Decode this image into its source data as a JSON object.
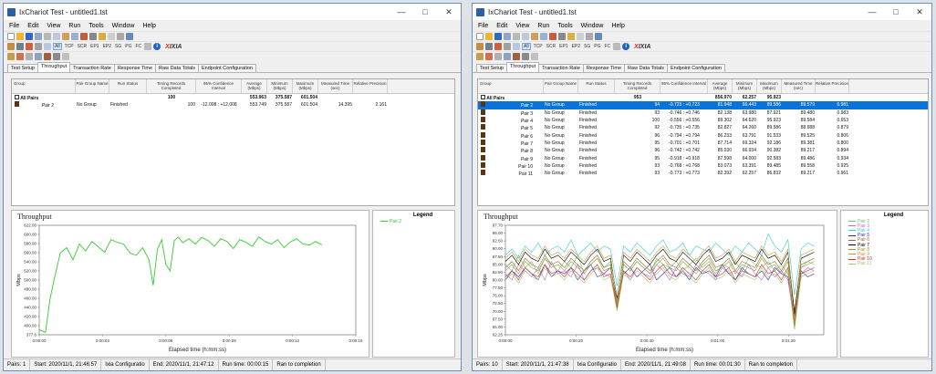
{
  "windows": [
    {
      "title": "IxChariot Test - untitled1.tst",
      "menu": [
        "File",
        "Edit",
        "View",
        "Run",
        "Tools",
        "Window",
        "Help"
      ],
      "toolbar2": [
        "All",
        "TCP",
        "SCR",
        "EP1",
        "EP2",
        "SG",
        "PG",
        "FC"
      ],
      "tabs": [
        "Test Setup",
        "Throughput",
        "Transaction Rate",
        "Response Time",
        "Raw Data Totals",
        "Endpoint Configuration"
      ],
      "active_tab": 1,
      "columns": [
        "Group",
        "Pair Group Name",
        "Run Status",
        "Timing Records Completed",
        "95% Confidence Interval",
        "Average (Mbps)",
        "Minimum (Mbps)",
        "Maximum (Mbps)",
        "Measured Time (sec)",
        "Relative Precision"
      ],
      "all_row": {
        "label": "All Pairs",
        "records": "100",
        "avg": "553.963",
        "min": "375.587",
        "max": "601.504"
      },
      "rows": [
        {
          "pair": "Pair 2",
          "group": "No Group",
          "status": "Finished",
          "records": "100",
          "ci": "-12.008 : +12.008",
          "avg": "553.749",
          "min": "375.587",
          "max": "601.504",
          "time": "14.395",
          "prec": "2.161"
        }
      ],
      "chart_title": "Throughput",
      "status": [
        "Pairs: 1",
        "Start: 2020/11/1, 21:46:57",
        "Ixia Configuratio",
        "End: 2020/11/1, 21:47:12",
        "Run time: 00:00:15",
        "Ran to completion"
      ]
    },
    {
      "title": "IxChariot Test - untitled1.tst",
      "menu": [
        "File",
        "Edit",
        "View",
        "Run",
        "Tools",
        "Window",
        "Help"
      ],
      "toolbar2": [
        "All",
        "TCP",
        "SCR",
        "EP1",
        "EP2",
        "SG",
        "PG",
        "FC"
      ],
      "tabs": [
        "Test Setup",
        "Throughput",
        "Transaction Rate",
        "Response Time",
        "Raw Data Totals",
        "Endpoint Configuration"
      ],
      "active_tab": 1,
      "columns": [
        "Group",
        "Pair Group Name",
        "Run Status",
        "Timing Records Completed",
        "95% Confidence Interval",
        "Average (Mbps)",
        "Minimum (Mbps)",
        "Maximum (Mbps)",
        "Measured Time (sec)",
        "Relative Precision"
      ],
      "all_row": {
        "label": "All Pairs",
        "records": "953",
        "avg": "856.970",
        "min": "62.257",
        "max": "95.923"
      },
      "rows": [
        {
          "pair": "Pair 2",
          "group": "No Group",
          "status": "Finished",
          "records": "94",
          "ci": "-0.723 : +0.723",
          "avg": "81.948",
          "min": "66.443",
          "max": "89.586",
          "time": "89.579",
          "prec": "0.981"
        },
        {
          "pair": "Pair 3",
          "group": "No Group",
          "status": "Finished",
          "records": "93",
          "ci": "-0.746 : +0.746",
          "avg": "82.138",
          "min": "63.980",
          "max": "87.921",
          "time": "89.480",
          "prec": "0.983"
        },
        {
          "pair": "Pair 4",
          "group": "No Group",
          "status": "Finished",
          "records": "100",
          "ci": "-0.556 : +0.556",
          "avg": "89.302",
          "min": "64.620",
          "max": "95.923",
          "time": "89.584",
          "prec": "0.653"
        },
        {
          "pair": "Pair 5",
          "group": "No Group",
          "status": "Finished",
          "records": "92",
          "ci": "-0.735 : +0.735",
          "avg": "82.827",
          "min": "64.260",
          "max": "89.586",
          "time": "88.988",
          "prec": "0.879"
        },
        {
          "pair": "Pair 6",
          "group": "No Group",
          "status": "Finished",
          "records": "96",
          "ci": "-0.794 : +0.794",
          "avg": "86.233",
          "min": "63.791",
          "max": "91.533",
          "time": "89.525",
          "prec": "0.806"
        },
        {
          "pair": "Pair 7",
          "group": "No Group",
          "status": "Finished",
          "records": "95",
          "ci": "-0.701 : +0.701",
          "avg": "87.714",
          "min": "69.324",
          "max": "92.186",
          "time": "89.381",
          "prec": "0.800"
        },
        {
          "pair": "Pair 8",
          "group": "No Group",
          "status": "Finished",
          "records": "96",
          "ci": "-0.742 : +0.742",
          "avg": "85.030",
          "min": "66.934",
          "max": "90.382",
          "time": "89.217",
          "prec": "0.894"
        },
        {
          "pair": "Pair 9",
          "group": "No Group",
          "status": "Finished",
          "records": "95",
          "ci": "-0.918 : +0.918",
          "avg": "87.598",
          "min": "64.000",
          "max": "92.583",
          "time": "89.486",
          "prec": "0.934"
        },
        {
          "pair": "Pair 10",
          "group": "No Group",
          "status": "Finished",
          "records": "93",
          "ci": "-0.768 : +0.768",
          "avg": "83.073",
          "min": "63.391",
          "max": "89.485",
          "time": "89.558",
          "prec": "0.925"
        },
        {
          "pair": "Pair 11",
          "group": "No Group",
          "status": "Finished",
          "records": "93",
          "ci": "-0.773 : +0.773",
          "avg": "82.392",
          "min": "62.257",
          "max": "86.832",
          "time": "89.217",
          "prec": "0.961"
        }
      ],
      "chart_title": "Throughput",
      "status": [
        "Pairs: 10",
        "Start: 2020/11/1, 21:47:38",
        "Ixia Configuratio",
        "End: 2020/11/1, 21:49:08",
        "Run time: 00:01:30",
        "Ran to completion"
      ]
    }
  ],
  "chart_data": [
    {
      "type": "line",
      "title": "Throughput",
      "xlabel": "Elapsed time (h:mm:ss)",
      "ylabel": "Mbps",
      "xlim": [
        0,
        15
      ],
      "ylim": [
        377.6,
        622
      ],
      "x_ticks": [
        "0:00:00",
        "0:00:03",
        "0:00:06",
        "0:00:09",
        "0:00:12",
        "0:00:15"
      ],
      "y_ticks": [
        "377.6",
        "400.00",
        "420.00",
        "440.00",
        "460.00",
        "480.00",
        "500.00",
        "520.00",
        "540.00",
        "560.00",
        "580.00",
        "600.00",
        "622.00"
      ],
      "legend": [
        "Pair 2"
      ],
      "series": [
        {
          "name": "Pair 2",
          "color": "#33cc33",
          "x": [
            0,
            0.3,
            0.5,
            0.7,
            1.0,
            1.3,
            1.6,
            1.9,
            2.2,
            2.5,
            2.8,
            3.1,
            3.4,
            3.7,
            4.0,
            4.3,
            4.6,
            4.9,
            5.2,
            5.4,
            5.6,
            5.8,
            6.0,
            6.2,
            6.4,
            6.6,
            6.8,
            7.1,
            7.4,
            7.7,
            8.0,
            8.3,
            8.6,
            8.9,
            9.2,
            9.5,
            9.8,
            10.1,
            10.4,
            10.7,
            11.0,
            11.3,
            11.6,
            11.9,
            12.2,
            12.5,
            12.8,
            13.1,
            13.4
          ],
          "values": [
            389,
            383,
            455,
            500,
            560,
            572,
            545,
            580,
            565,
            586,
            574,
            562,
            590,
            584,
            580,
            560,
            555,
            572,
            545,
            488,
            568,
            590,
            535,
            520,
            588,
            596,
            583,
            592,
            580,
            595,
            588,
            575,
            592,
            586,
            570,
            590,
            584,
            575,
            596,
            586,
            580,
            590,
            572,
            585,
            592,
            580,
            578,
            586,
            578
          ]
        }
      ]
    },
    {
      "type": "line",
      "title": "Throughput",
      "xlabel": "Elapsed time (h:mm:ss)",
      "ylabel": "Mbps",
      "xlim": [
        0,
        90
      ],
      "ylim": [
        62.25,
        97.7
      ],
      "x_ticks": [
        "0:00:00",
        "0:00:20",
        "0:00:40",
        "0:01:00",
        "0:01:20"
      ],
      "y_ticks": [
        "62.25",
        "65.00",
        "67.50",
        "70.00",
        "72.50",
        "75.00",
        "77.50",
        "80.00",
        "82.50",
        "85.00",
        "87.50",
        "90.00",
        "92.50",
        "95.00",
        "97.70"
      ],
      "legend": [
        "Pair 2",
        "Pair 3",
        "Pair 4",
        "Pair 5",
        "Pair 6",
        "Pair 7",
        "Pair 8",
        "Pair 9",
        "Pair 10",
        "Pair 11"
      ],
      "series": [
        {
          "name": "Pair 2",
          "color": "#66cc66",
          "values": [
            85,
            83,
            88,
            84,
            86,
            82,
            87,
            85,
            83,
            86,
            84,
            88,
            82,
            85,
            87,
            84,
            86,
            70,
            85,
            83,
            86,
            84,
            82,
            87,
            85,
            84,
            86,
            83,
            85,
            87,
            84,
            86,
            82,
            85,
            84,
            86,
            83,
            87,
            85,
            84,
            86,
            83,
            85,
            82,
            64,
            84,
            86,
            85
          ]
        },
        {
          "name": "Pair 3",
          "color": "#cc66cc",
          "values": [
            82,
            80,
            85,
            83,
            81,
            84,
            80,
            86,
            82,
            83,
            81,
            85,
            80,
            83,
            84,
            82,
            81,
            72,
            83,
            80,
            84,
            82,
            81,
            85,
            83,
            80,
            84,
            82,
            81,
            85,
            83,
            82,
            80,
            84,
            82,
            83,
            81,
            85,
            82,
            80,
            84,
            81,
            83,
            80,
            66,
            82,
            84,
            83
          ]
        },
        {
          "name": "Pair 4",
          "color": "#33cccc",
          "values": [
            88,
            90,
            87,
            91,
            89,
            92,
            88,
            90,
            91,
            89,
            93,
            88,
            90,
            92,
            89,
            91,
            90,
            78,
            91,
            89,
            92,
            90,
            88,
            91,
            93,
            89,
            90,
            92,
            88,
            91,
            90,
            89,
            92,
            90,
            88,
            91,
            89,
            92,
            90,
            88,
            95,
            91,
            89,
            93,
            75,
            90,
            92,
            91
          ]
        },
        {
          "name": "Pair 5",
          "color": "#3333aa",
          "values": [
            80,
            83,
            81,
            84,
            82,
            80,
            85,
            81,
            83,
            82,
            84,
            80,
            83,
            85,
            81,
            82,
            84,
            73,
            82,
            84,
            81,
            83,
            85,
            80,
            82,
            84,
            81,
            83,
            80,
            84,
            82,
            83,
            81,
            85,
            82,
            80,
            84,
            82,
            81,
            83,
            80,
            84,
            82,
            81,
            68,
            83,
            81,
            82
          ]
        },
        {
          "name": "Pair 6",
          "color": "#996633",
          "values": [
            84,
            86,
            83,
            87,
            85,
            84,
            88,
            85,
            86,
            84,
            87,
            85,
            83,
            86,
            88,
            84,
            85,
            71,
            86,
            84,
            87,
            85,
            83,
            86,
            88,
            85,
            84,
            87,
            85,
            83,
            86,
            88,
            84,
            85,
            87,
            83,
            86,
            85,
            84,
            88,
            85,
            86,
            83,
            87,
            70,
            85,
            86,
            87
          ]
        },
        {
          "name": "Pair 7",
          "color": "#000000",
          "values": [
            86,
            88,
            85,
            89,
            87,
            86,
            90,
            87,
            88,
            86,
            89,
            87,
            85,
            88,
            90,
            86,
            87,
            74,
            88,
            86,
            89,
            87,
            85,
            88,
            90,
            87,
            86,
            89,
            87,
            85,
            88,
            90,
            86,
            87,
            89,
            85,
            88,
            87,
            86,
            90,
            87,
            88,
            85,
            89,
            69,
            87,
            88,
            89
          ]
        },
        {
          "name": "Pair 8",
          "color": "#999933",
          "values": [
            83,
            85,
            82,
            86,
            84,
            83,
            87,
            84,
            85,
            83,
            86,
            84,
            82,
            85,
            87,
            83,
            84,
            72,
            85,
            83,
            86,
            84,
            82,
            85,
            87,
            84,
            83,
            86,
            84,
            82,
            85,
            87,
            83,
            84,
            86,
            82,
            85,
            84,
            83,
            87,
            84,
            85,
            82,
            86,
            67,
            84,
            85,
            86
          ]
        },
        {
          "name": "Pair 9",
          "color": "#cc9933",
          "values": [
            87,
            89,
            86,
            90,
            88,
            87,
            91,
            88,
            89,
            87,
            90,
            88,
            86,
            89,
            91,
            87,
            88,
            73,
            89,
            87,
            90,
            88,
            86,
            89,
            91,
            88,
            87,
            90,
            88,
            86,
            89,
            91,
            87,
            88,
            90,
            86,
            89,
            88,
            87,
            91,
            88,
            89,
            86,
            90,
            66,
            88,
            89,
            90
          ]
        },
        {
          "name": "Pair 10",
          "color": "#cc3333",
          "values": [
            81,
            83,
            80,
            84,
            82,
            81,
            85,
            82,
            83,
            81,
            84,
            82,
            80,
            83,
            85,
            81,
            82,
            71,
            83,
            81,
            84,
            82,
            80,
            83,
            85,
            82,
            81,
            84,
            82,
            80,
            83,
            85,
            81,
            82,
            84,
            80,
            83,
            82,
            81,
            85,
            82,
            83,
            80,
            84,
            65,
            82,
            83,
            84
          ]
        },
        {
          "name": "Pair 11",
          "color": "#99cc66",
          "values": [
            80,
            82,
            79,
            83,
            81,
            80,
            84,
            81,
            82,
            80,
            83,
            81,
            79,
            82,
            84,
            80,
            81,
            70,
            82,
            80,
            83,
            81,
            79,
            82,
            84,
            81,
            80,
            83,
            81,
            79,
            82,
            84,
            80,
            81,
            83,
            79,
            82,
            81,
            80,
            84,
            81,
            82,
            79,
            83,
            64,
            81,
            82,
            83
          ]
        }
      ]
    }
  ]
}
